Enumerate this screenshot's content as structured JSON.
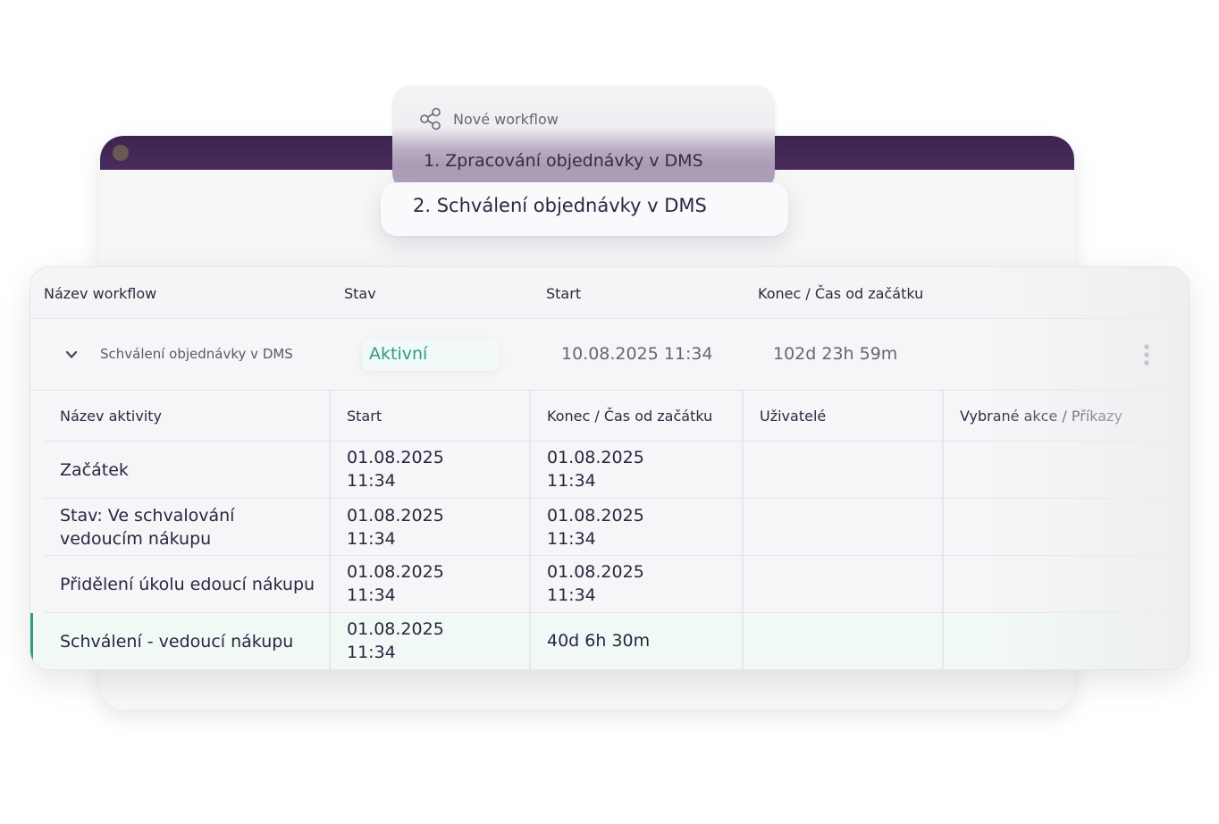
{
  "popup": {
    "header_icon": "share-nodes-icon",
    "header_label": "Nové workflow",
    "items": [
      "1. Zpracování objednávky v DMS",
      "2. Schválení objednávky v DMS"
    ]
  },
  "table": {
    "headers": {
      "name": "Název workflow",
      "status": "Stav",
      "start": "Start",
      "end": "Konec / Čas od začátku"
    },
    "workflow": {
      "name": "Schválení objednávky v DMS",
      "status": "Aktivní",
      "start": "10.08.2025 11:34",
      "elapsed": "102d 23h 59m"
    }
  },
  "activities": {
    "headers": {
      "name": "Název aktivity",
      "start": "Start",
      "end": "Konec / Čas od začátku",
      "users": "Uživatelé",
      "actions": "Vybrané akce / Příkazy"
    },
    "rows": [
      {
        "name": [
          "Začátek"
        ],
        "start": [
          "01.08.2025",
          "11:34"
        ],
        "end": [
          "01.08.2025",
          "11:34"
        ]
      },
      {
        "name": [
          "Stav: Ve schvalování",
          "vedoucím nákupu"
        ],
        "start": [
          "01.08.2025",
          "11:34"
        ],
        "end": [
          "01.08.2025",
          "11:34"
        ]
      },
      {
        "name": [
          "Přidělení úkolu edoucí nákupu"
        ],
        "start": [
          "01.08.2025",
          "11:34"
        ],
        "end": [
          "01.08.2025",
          "11:34"
        ]
      },
      {
        "name": [
          "Schválení - vedoucí nákupu"
        ],
        "start": [
          "01.08.2025",
          "11:34"
        ],
        "end": [
          "40d 6h 30m"
        ]
      }
    ]
  },
  "colors": {
    "brand_purple": "#4a2c5c",
    "status_green": "#2f9b86"
  }
}
